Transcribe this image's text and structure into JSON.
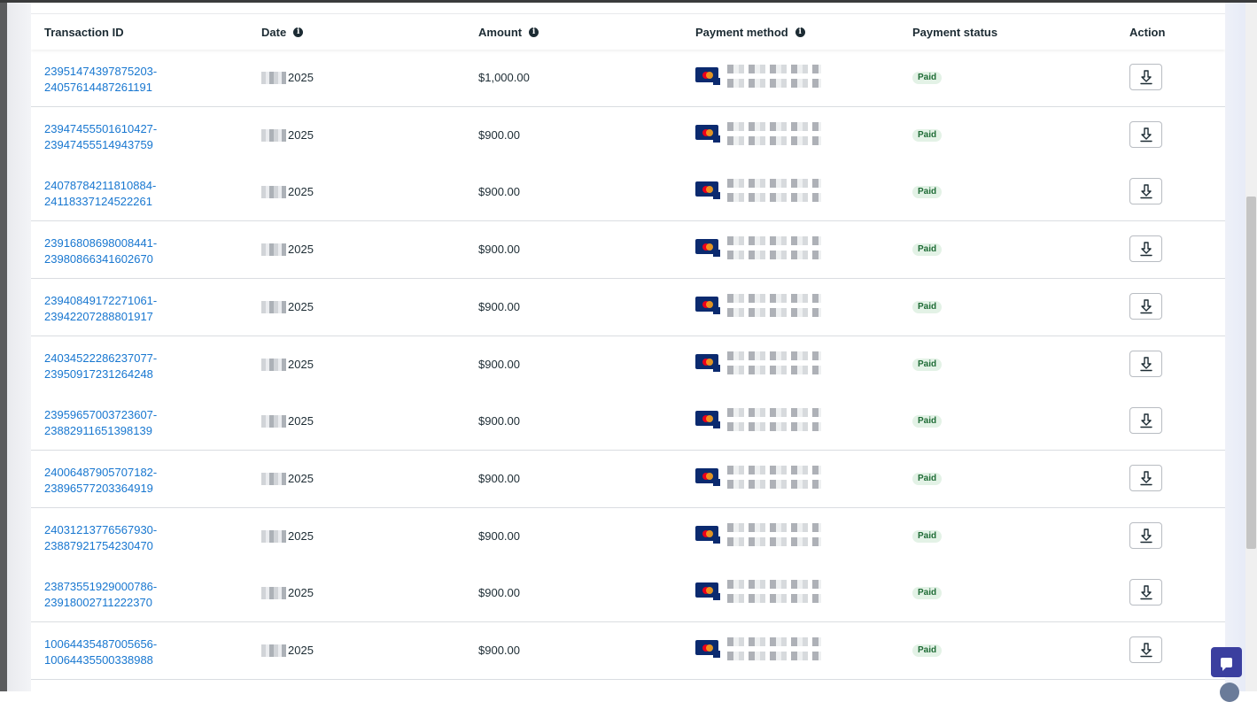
{
  "table": {
    "headers": {
      "transaction_id": "Transaction ID",
      "date": "Date",
      "amount": "Amount",
      "payment_method": "Payment method",
      "payment_status": "Payment status",
      "action": "Action"
    },
    "rows": [
      {
        "id_line1": "23951474397875203-",
        "id_line2": "24057614487261191",
        "date": "2025",
        "amount": "$1,000.00",
        "status": "Paid"
      },
      {
        "id_line1": "23947455501610427-",
        "id_line2": "23947455514943759",
        "date": "2025",
        "amount": "$900.00",
        "status": "Paid"
      },
      {
        "id_line1": "24078784211810884-",
        "id_line2": "24118337124522261",
        "date": "2025",
        "amount": "$900.00",
        "status": "Paid"
      },
      {
        "id_line1": "23916808698008441-",
        "id_line2": "23980866341602670",
        "date": "2025",
        "amount": "$900.00",
        "status": "Paid"
      },
      {
        "id_line1": "23940849172271061-",
        "id_line2": "23942207288801917",
        "date": "2025",
        "amount": "$900.00",
        "status": "Paid"
      },
      {
        "id_line1": "24034522286237077-",
        "id_line2": "23950917231264248",
        "date": "2025",
        "amount": "$900.00",
        "status": "Paid"
      },
      {
        "id_line1": "23959657003723607-",
        "id_line2": "23882911651398139",
        "date": "2025",
        "amount": "$900.00",
        "status": "Paid"
      },
      {
        "id_line1": "24006487905707182-",
        "id_line2": "23896577203364919",
        "date": "2025",
        "amount": "$900.00",
        "status": "Paid"
      },
      {
        "id_line1": "24031213776567930-",
        "id_line2": "23887921754230470",
        "date": "2025",
        "amount": "$900.00",
        "status": "Paid"
      },
      {
        "id_line1": "23873551929000786-",
        "id_line2": "23918002711222370",
        "date": "2025",
        "amount": "$900.00",
        "status": "Paid"
      },
      {
        "id_line1": "10064435487005656-",
        "id_line2": "10064435500338988",
        "date": "2025",
        "amount": "$900.00",
        "status": "Paid"
      }
    ]
  },
  "colors": {
    "link": "#1877d0",
    "paid_badge_bg": "#e3f2e6",
    "paid_badge_text": "#1e6b35",
    "card_brand": "#0b2a6f",
    "chat_button": "#3b3f9f"
  },
  "icons": {
    "info": "info-icon",
    "download": "download-icon",
    "card": "mastercard-icon",
    "chat": "chat-icon",
    "globe": "globe-icon"
  }
}
